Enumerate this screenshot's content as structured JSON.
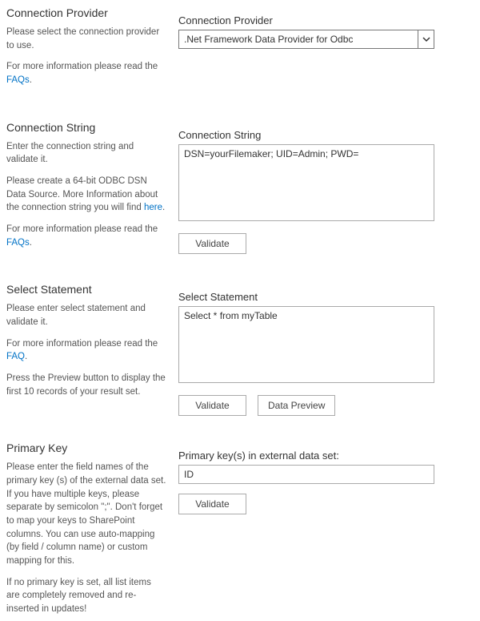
{
  "sections": {
    "provider": {
      "title": "Connection Provider",
      "desc1": "Please select the connection provider to use.",
      "desc2_pre": "For more information please read the ",
      "desc2_link": "FAQs",
      "desc2_post": ".",
      "field_label": "Connection Provider",
      "value": ".Net Framework Data Provider for Odbc"
    },
    "connstr": {
      "title": "Connection String",
      "desc1": "Enter the connection string and validate it.",
      "desc2_pre": "Please create a 64-bit ODBC DSN Data Source. More Information about the connection string you will find ",
      "desc2_link": "here",
      "desc2_post": ".",
      "desc3_pre": "For more information please read the ",
      "desc3_link": "FAQs",
      "desc3_post": ".",
      "field_label": "Connection String",
      "value": "DSN=yourFilemaker; UID=Admin; PWD=",
      "validate_btn": "Validate"
    },
    "select": {
      "title": "Select Statement",
      "desc1": "Please enter select statement and validate it.",
      "desc2_pre": "For more information please read the ",
      "desc2_link": "FAQ",
      "desc2_post": ".",
      "desc3": "Press the Preview button to display the first 10 records of your result set.",
      "field_label": "Select Statement",
      "value": "Select * from myTable",
      "validate_btn": "Validate",
      "preview_btn": "Data Preview"
    },
    "pkey": {
      "title": "Primary Key",
      "desc1": "Please enter the field names of the primary key (s) of the external data set. If you have multiple keys, please separate by semicolon \";\". Don't forget to map your keys to SharePoint columns. You can use auto-mapping (by field / column name) or custom mapping for this.",
      "desc2": "If no primary key is set, all list items are completely removed and re-inserted in updates!",
      "field_label": "Primary key(s) in external data set:",
      "value": "ID",
      "validate_btn": "Validate"
    }
  }
}
